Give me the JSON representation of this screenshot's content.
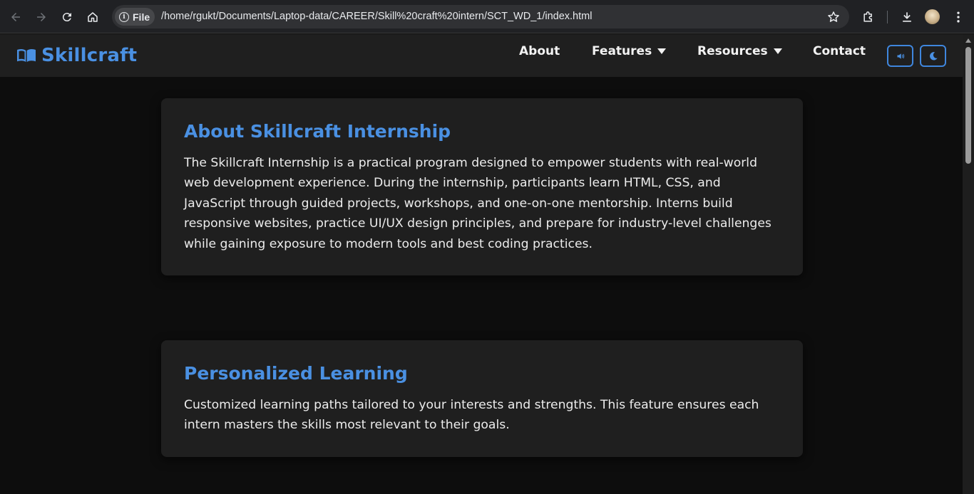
{
  "browser": {
    "file_label": "File",
    "url": "/home/rgukt/Documents/Laptop-data/CAREER/Skill%20craft%20intern/SCT_WD_1/index.html"
  },
  "site": {
    "logo_text": "Skillcraft",
    "accent_color": "#4a90e2",
    "nav": [
      {
        "label": "About"
      },
      {
        "label": "Features"
      },
      {
        "label": "Resources"
      },
      {
        "label": "Contact"
      }
    ]
  },
  "cards": [
    {
      "title": "About Skillcraft Internship",
      "body": "The Skillcraft Internship is a practical program designed to empower students with real-world web development experience. During the internship, participants learn HTML, CSS, and JavaScript through guided projects, workshops, and one-on-one mentorship. Interns build responsive websites, practice UI/UX design principles, and prepare for industry-level challenges while gaining exposure to modern tools and best coding practices."
    },
    {
      "title": "Personalized Learning",
      "body": "Customized learning paths tailored to your interests and strengths. This feature ensures each intern masters the skills most relevant to their goals."
    }
  ]
}
